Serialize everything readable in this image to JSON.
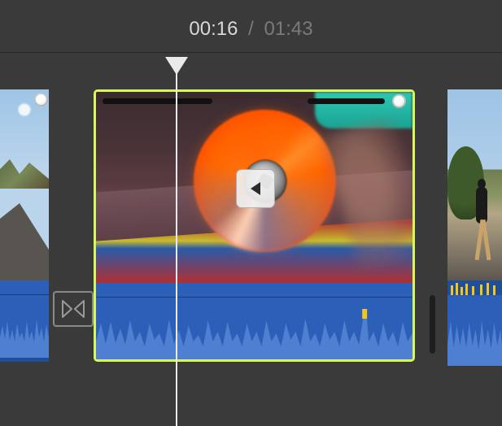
{
  "timecode": {
    "current": "00:16",
    "separator": "/",
    "total": "01:43"
  },
  "clips": {
    "selected": {
      "direction_icon": "reverse-play"
    }
  },
  "transition": {
    "type": "cross-dissolve"
  }
}
